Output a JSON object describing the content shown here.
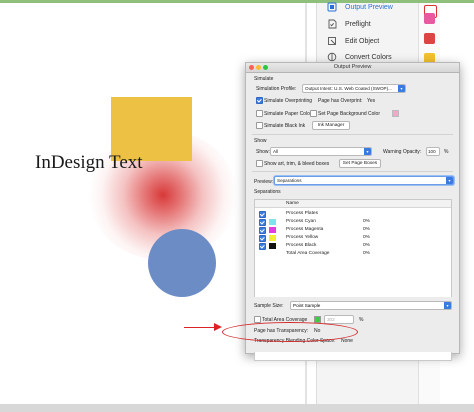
{
  "document": {
    "text": "InDesign Text",
    "colors": {
      "yellow": "#ecc144",
      "red": "#d62e2e",
      "blue": "#6c8cc6"
    }
  },
  "tools": {
    "items": [
      {
        "label": "Output Preview",
        "icon": "output-preview-icon",
        "active": true
      },
      {
        "label": "Preflight",
        "icon": "preflight-icon",
        "active": false
      },
      {
        "label": "Edit Object",
        "icon": "edit-object-icon",
        "active": false
      },
      {
        "label": "Convert Colors",
        "icon": "convert-colors-icon",
        "active": false
      }
    ]
  },
  "dialog": {
    "title": "Output Preview",
    "simulate": {
      "section": "Simulate",
      "profile_label": "Simulation Profile:",
      "profile_value": "Output Intent: U.S. Web Coated (SWOP)...",
      "overprinting_label": "Simulate Overprinting",
      "overprinting_checked": true,
      "overprint_label": "Page has Overprint:",
      "overprint_value": "Yes",
      "paper_color_label": "Simulate Paper Color",
      "set_bg_label": "Set Page Background Color",
      "black_ink_label": "Simulate Black Ink",
      "ink_manager_label": "Ink Manager"
    },
    "show": {
      "section": "Show",
      "show_label": "Show:",
      "show_value": "All",
      "warning_label": "Warning Opacity:",
      "warning_value": "100",
      "warning_unit": "%",
      "art_trim_label": "Show art, trim, & bleed boxes",
      "page_boxes_label": "Set Page Boxes"
    },
    "preview": {
      "label": "Preview:",
      "value": "Separations"
    },
    "separations": {
      "section": "Separations",
      "column_name": "Name",
      "rows": [
        {
          "name": "Process Plates",
          "color": "",
          "value": "",
          "checked": true
        },
        {
          "name": "Process Cyan",
          "color": "#7ee3ea",
          "value": "0%",
          "checked": true
        },
        {
          "name": "Process Magenta",
          "color": "#e23ce3",
          "value": "0%",
          "checked": true
        },
        {
          "name": "Process Yellow",
          "color": "#f4ee32",
          "value": "0%",
          "checked": true
        },
        {
          "name": "Process Black",
          "color": "#111111",
          "value": "0%",
          "checked": true
        },
        {
          "name": "Total Area Coverage",
          "color": "",
          "value": "0%",
          "checked": false
        }
      ]
    },
    "sample": {
      "label": "Sample Size:",
      "value": "Point Sample",
      "total_area_label": "Total Area Coverage",
      "total_area_value": "302",
      "total_area_unit": "%"
    },
    "transparency": {
      "label": "Page has Transparency:",
      "value": "No",
      "blending_label": "Transparency Blending Color Space:",
      "blending_value": "None"
    }
  }
}
